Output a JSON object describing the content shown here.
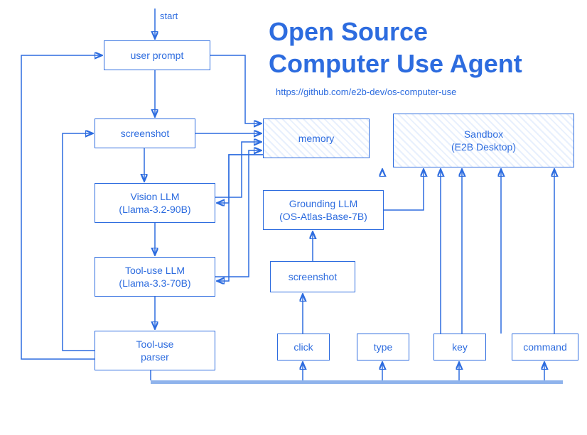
{
  "title_line1": "Open Source",
  "title_line2": "Computer Use Agent",
  "subtitle": "https://github.com/e2b-dev/os-computer-use",
  "labels": {
    "start": "start"
  },
  "nodes": {
    "user_prompt": "user prompt",
    "screenshot1": "screenshot",
    "vision_llm_l1": "Vision LLM",
    "vision_llm_l2": "(Llama-3.2-90B)",
    "tooluse_llm_l1": "Tool-use LLM",
    "tooluse_llm_l2": "(Llama-3.3-70B)",
    "tooluse_parser_l1": "Tool-use",
    "tooluse_parser_l2": "parser",
    "memory": "memory",
    "sandbox_l1": "Sandbox",
    "sandbox_l2": "(E2B Desktop)",
    "grounding_l1": "Grounding LLM",
    "grounding_l2": "(OS-Atlas-Base-7B)",
    "screenshot2": "screenshot",
    "click": "click",
    "type": "type",
    "key": "key",
    "command": "command"
  }
}
